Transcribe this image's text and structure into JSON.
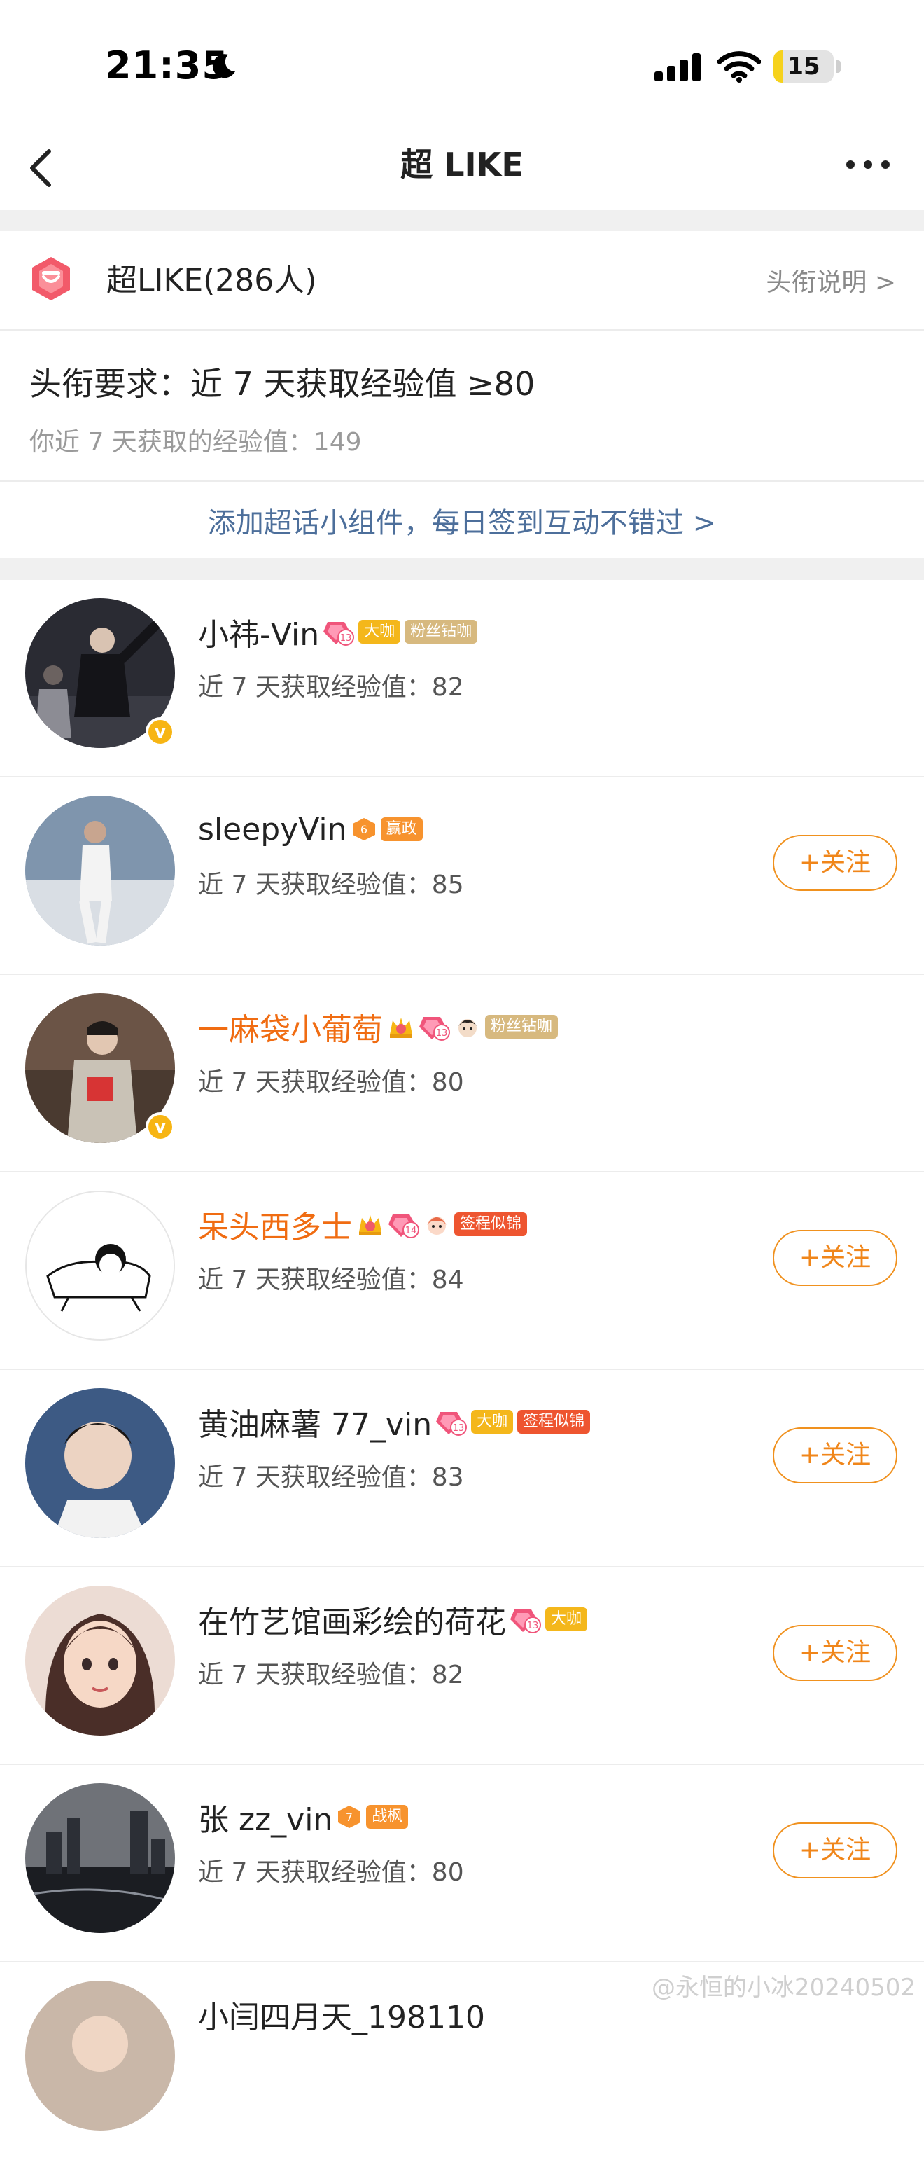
{
  "status_bar": {
    "time": "21:35",
    "battery": "15",
    "battery_level": 0.15
  },
  "nav": {
    "title": "超 LIKE"
  },
  "header": {
    "title": "超LIKE(286人)",
    "link": "头衔说明 >"
  },
  "requirement": {
    "title": "头衔要求：近 7 天获取经验值 ≥80",
    "sub": "你近 7 天获取的经验值：149"
  },
  "widget_link": "添加超话小组件，每日签到互动不错过 >",
  "follow_label": "+关注",
  "users": [
    {
      "name": "小祎-Vin",
      "exp": "近 7 天获取经验值：82",
      "level": "13",
      "tags": [
        "大咖",
        "粉丝钻咖"
      ],
      "follow": false,
      "verified": true
    },
    {
      "name": "sleepyVin",
      "exp": "近 7 天获取经验值：85",
      "level": "6",
      "tags": [
        "赢政"
      ],
      "follow": true,
      "verified": false
    },
    {
      "name": "一麻袋小葡萄",
      "exp": "近 7 天获取经验值：80",
      "level": "13",
      "tags": [
        "粉丝钻咖"
      ],
      "follow": false,
      "verified": true
    },
    {
      "name": "呆头西多士",
      "exp": "近 7 天获取经验值：84",
      "level": "14",
      "tags": [
        "签程似锦"
      ],
      "follow": true,
      "verified": false
    },
    {
      "name": "黄油麻薯 77_vin",
      "exp": "近 7 天获取经验值：83",
      "level": "13",
      "tags": [
        "大咖",
        "签程似锦"
      ],
      "follow": true,
      "verified": false
    },
    {
      "name": "在竹艺馆画彩绘的荷花",
      "exp": "近 7 天获取经验值：82",
      "level": "13",
      "tags": [
        "大咖"
      ],
      "follow": true,
      "verified": false
    },
    {
      "name": "张 zz_vin",
      "exp": "近 7 天获取经验值：80",
      "level": "7",
      "tags": [
        "战枫"
      ],
      "follow": true,
      "verified": false
    },
    {
      "name": "小闫四月天_198110",
      "exp": "",
      "level": "",
      "tags": [],
      "follow": false,
      "verified": false
    }
  ],
  "watermark": "@永恒的小冰20240502"
}
